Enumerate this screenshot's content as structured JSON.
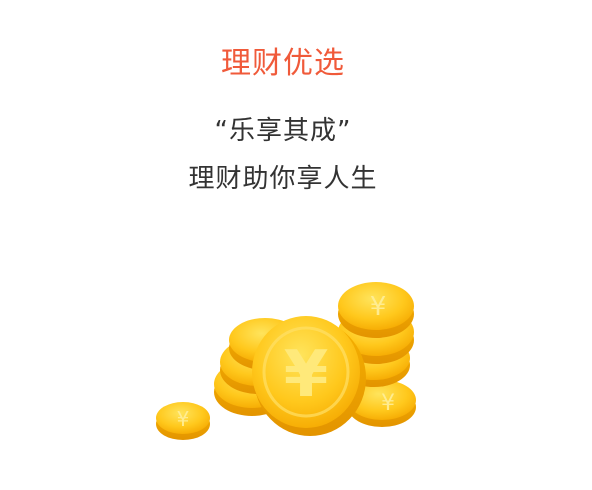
{
  "header": {
    "title": "理财优选",
    "title_color": "#f05a3a"
  },
  "slogan": {
    "line1": "“乐享其成”",
    "line2": "理财助你享人生"
  },
  "illustration": {
    "icon": "gold-coins-yuan-icon",
    "coin_symbol": "¥",
    "coin_color": "#ffc21a"
  }
}
